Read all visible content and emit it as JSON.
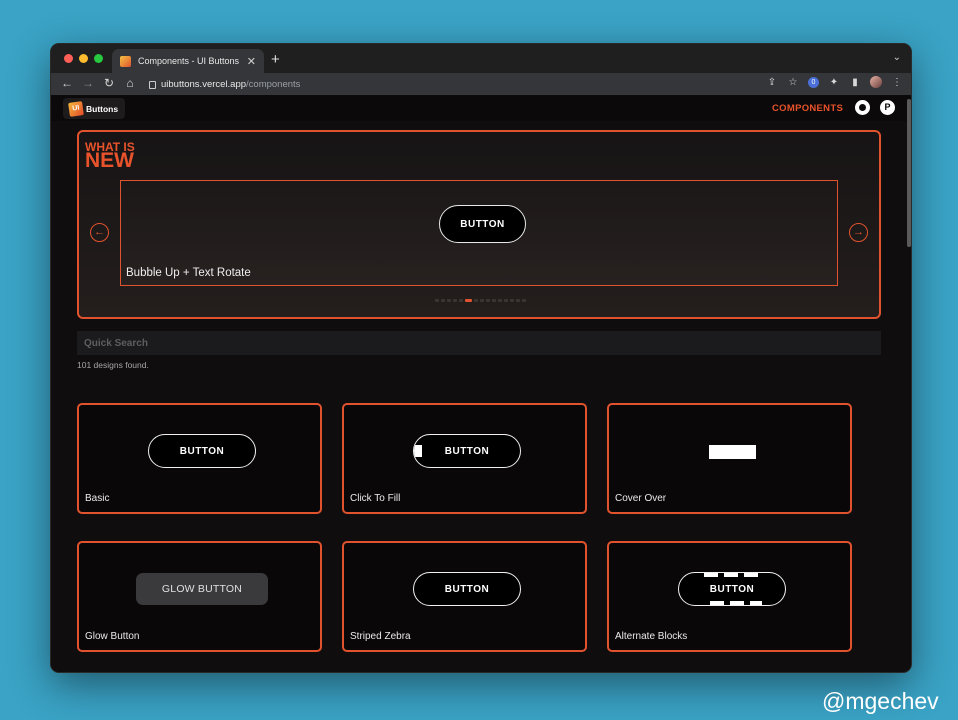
{
  "browser": {
    "tab_title": "Components - UI Buttons",
    "tab_close": "✕",
    "new_tab": "+",
    "tab_menu": "⌄",
    "url_host": "uibuttons.vercel.app",
    "url_path": "/components",
    "back": "←",
    "forward": "→",
    "reload": "↻",
    "home": "⌂",
    "share": "⇪",
    "star": "☆",
    "ext_letter": "0",
    "puzzle": "✦",
    "sidepanel": "▮",
    "menu": "⋮"
  },
  "site": {
    "logo_mark": "UI",
    "logo_text": "Buttons",
    "nav_components": "COMPONENTS",
    "profile_letter": "P"
  },
  "hero": {
    "what_is": "WHAT IS",
    "new": "NEW",
    "slide_button": "BUTTON",
    "slide_label": "Bubble Up + Text Rotate",
    "prev": "←",
    "next": "→",
    "dot_count": 15,
    "active_dot": 5
  },
  "search": {
    "placeholder": "Quick Search",
    "result_count": "101 designs found."
  },
  "cards": [
    {
      "label": "Basic",
      "button": "BUTTON"
    },
    {
      "label": "Click To Fill",
      "button": "BUTTON"
    },
    {
      "label": "Cover Over",
      "button": ""
    },
    {
      "label": "Glow Button",
      "button": "GLOW BUTTON"
    },
    {
      "label": "Striped Zebra",
      "button": "BUTTON"
    },
    {
      "label": "Alternate Blocks",
      "button": "BUTTON"
    }
  ],
  "watermark": "@mgechev",
  "colors": {
    "accent": "#e0532e",
    "background": "#3aa3c6",
    "page_bg": "#100d0e"
  }
}
